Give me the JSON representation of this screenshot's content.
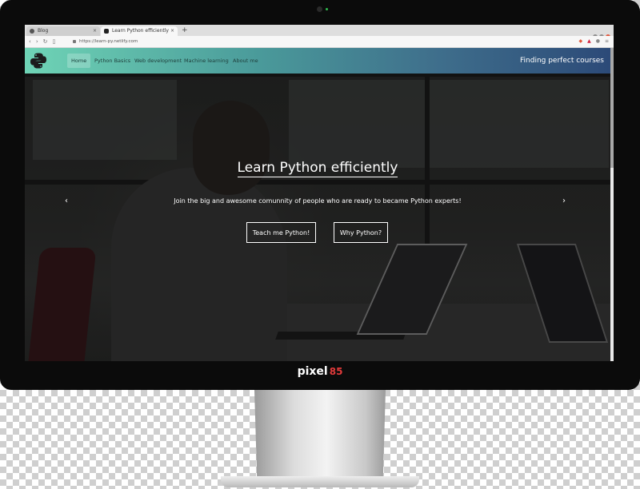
{
  "browser": {
    "tabs": [
      {
        "title": "Blog",
        "active": false
      },
      {
        "title": "Learn Python efficiently",
        "active": true
      }
    ],
    "url": "https://learn-py.netlify.com"
  },
  "navbar": {
    "items": [
      "Home",
      "Python Basics",
      "Web development",
      "Machine learning",
      "About me"
    ],
    "active_item": "Home",
    "brand_text": "Finding perfect courses"
  },
  "hero": {
    "title": "Learn Python efficiently",
    "subtitle": "Join the big and awesome comunnity of people who are ready to became Python experts!",
    "buttons": [
      "Teach me Python!",
      "Why Python?"
    ]
  },
  "icons": {
    "logo": "python-logo-icon",
    "prev": "chevron-left-icon",
    "next": "chevron-right-icon"
  },
  "colors": {
    "navbar_gradient": [
      "#6fd4b6",
      "#2c4a78"
    ],
    "button_border": "#ffffff"
  },
  "monitor": {
    "brand": "pixel",
    "brand_number": "85"
  }
}
